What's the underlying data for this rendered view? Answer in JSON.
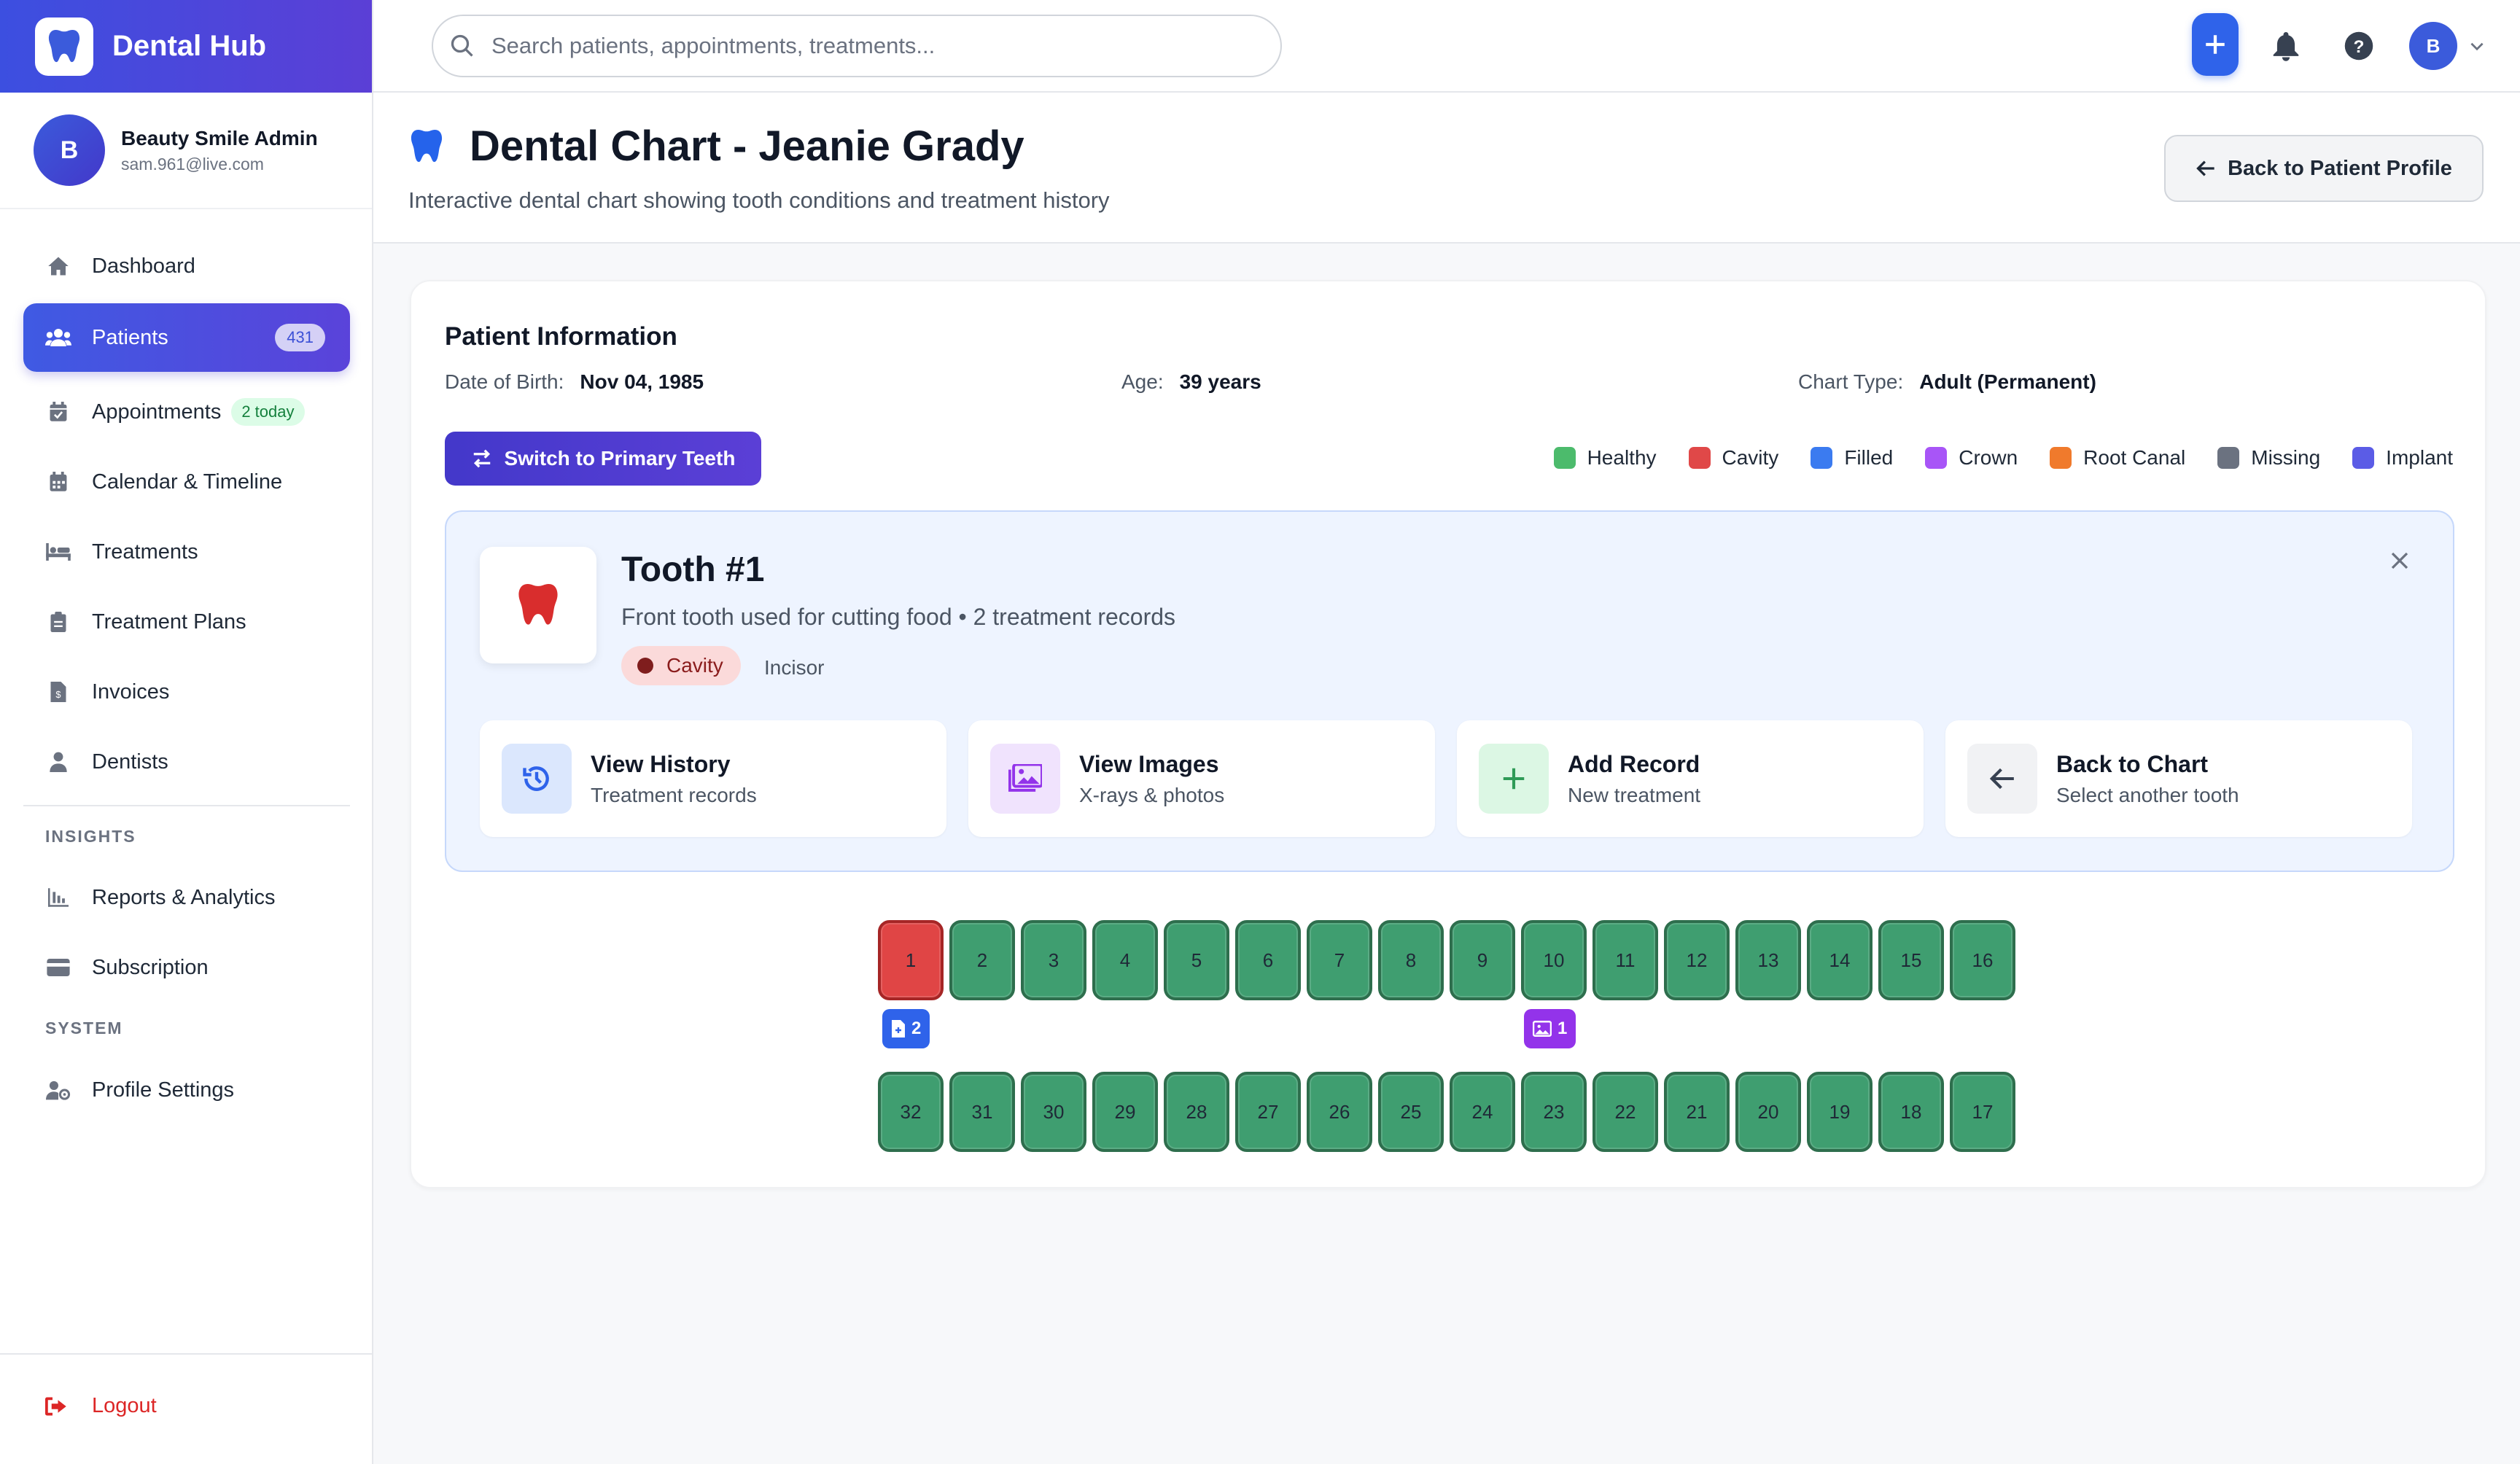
{
  "app": {
    "name": "Dental Hub"
  },
  "user": {
    "initial": "B",
    "name": "Beauty Smile Admin",
    "email": "sam.961@live.com"
  },
  "nav": {
    "dashboard": "Dashboard",
    "patients": "Patients",
    "patients_count": "431",
    "appointments": "Appointments",
    "appointments_badge": "2 today",
    "calendar": "Calendar & Timeline",
    "treatments": "Treatments",
    "treatment_plans": "Treatment Plans",
    "invoices": "Invoices",
    "dentists": "Dentists",
    "insights_section": "INSIGHTS",
    "reports": "Reports & Analytics",
    "subscription": "Subscription",
    "system_section": "SYSTEM",
    "profile_settings": "Profile Settings",
    "logout": "Logout"
  },
  "topbar": {
    "search_placeholder": "Search patients, appointments, treatments...",
    "avatar_initial": "B"
  },
  "page": {
    "title": "Dental Chart - Jeanie Grady",
    "subtitle": "Interactive dental chart showing tooth conditions and treatment history",
    "back_button": "Back to Patient Profile"
  },
  "patient_info": {
    "heading": "Patient Information",
    "dob_label": "Date of Birth:",
    "dob": "Nov 04, 1985",
    "age_label": "Age:",
    "age": "39 years",
    "chart_type_label": "Chart Type:",
    "chart_type": "Adult (Permanent)"
  },
  "switch_button": "Switch to Primary Teeth",
  "legend": [
    {
      "label": "Healthy",
      "color": "#4cbb6c"
    },
    {
      "label": "Cavity",
      "color": "#e04848"
    },
    {
      "label": "Filled",
      "color": "#3b7bf0"
    },
    {
      "label": "Crown",
      "color": "#a855f7"
    },
    {
      "label": "Root Canal",
      "color": "#f07a2c"
    },
    {
      "label": "Missing",
      "color": "#6b7280"
    },
    {
      "label": "Implant",
      "color": "#5b5ce6"
    }
  ],
  "selected_tooth": {
    "title": "Tooth #1",
    "description": "Front tooth used for cutting food • 2 treatment records",
    "condition": "Cavity",
    "type": "Incisor"
  },
  "actions": [
    {
      "title": "View History",
      "subtitle": "Treatment records"
    },
    {
      "title": "View Images",
      "subtitle": "X-rays & photos"
    },
    {
      "title": "Add Record",
      "subtitle": "New treatment"
    },
    {
      "title": "Back to Chart",
      "subtitle": "Select another tooth"
    }
  ],
  "teeth": {
    "upper": [
      "1",
      "2",
      "3",
      "4",
      "5",
      "6",
      "7",
      "8",
      "9",
      "10",
      "11",
      "12",
      "13",
      "14",
      "15",
      "16"
    ],
    "lower": [
      "32",
      "31",
      "30",
      "29",
      "28",
      "27",
      "26",
      "25",
      "24",
      "23",
      "22",
      "21",
      "20",
      "19",
      "18",
      "17"
    ],
    "markers": {
      "tooth1_records": "2",
      "tooth10_images": "1"
    }
  },
  "colors": {
    "accent": "#4338ca",
    "healthy_tooth": "#3f9e70",
    "cavity_tooth": "#e04545"
  }
}
